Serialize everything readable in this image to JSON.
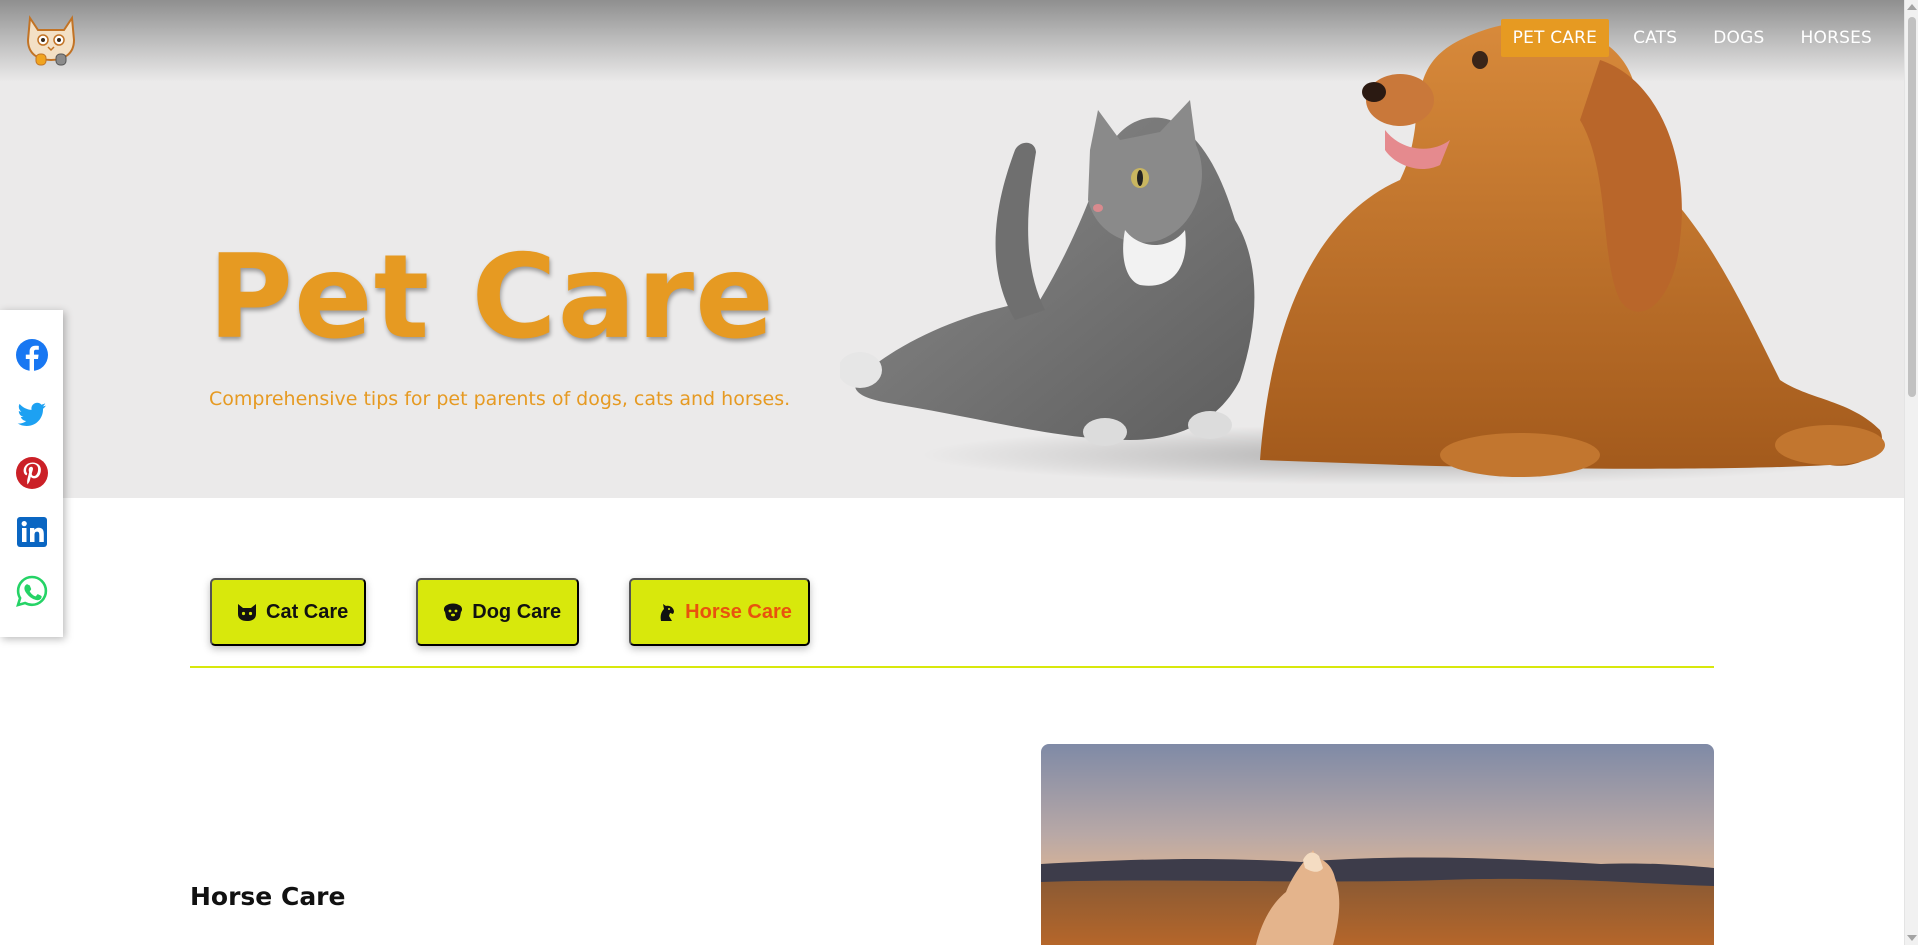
{
  "header": {
    "logo": "cat-logo",
    "nav": [
      "PET CARE",
      "CATS",
      "DOGS",
      "HORSES"
    ],
    "active_nav": "PET CARE"
  },
  "hero": {
    "title": "Pet Care",
    "subtitle": "Comprehensive tips for pet parents of dogs, cats and horses.",
    "image": "cat-and-dog-photo"
  },
  "social": {
    "links": [
      "facebook-icon",
      "twitter-icon",
      "pinterest-icon",
      "linkedin-icon",
      "whatsapp-icon"
    ]
  },
  "tabs": {
    "items": [
      {
        "label": "Cat Care",
        "icon": "cat-icon"
      },
      {
        "label": "Dog Care",
        "icon": "dog-icon"
      },
      {
        "label": "Horse Care",
        "icon": "horse-icon"
      }
    ],
    "active": "Horse Care"
  },
  "content": {
    "section_title": "Horse Care",
    "image": "horse-photo"
  },
  "colors": {
    "accent_orange": "#e69a22",
    "tab_lime": "#d8e80c",
    "active_tab_text": "#e8520e",
    "hero_background": "#ebeaea"
  }
}
